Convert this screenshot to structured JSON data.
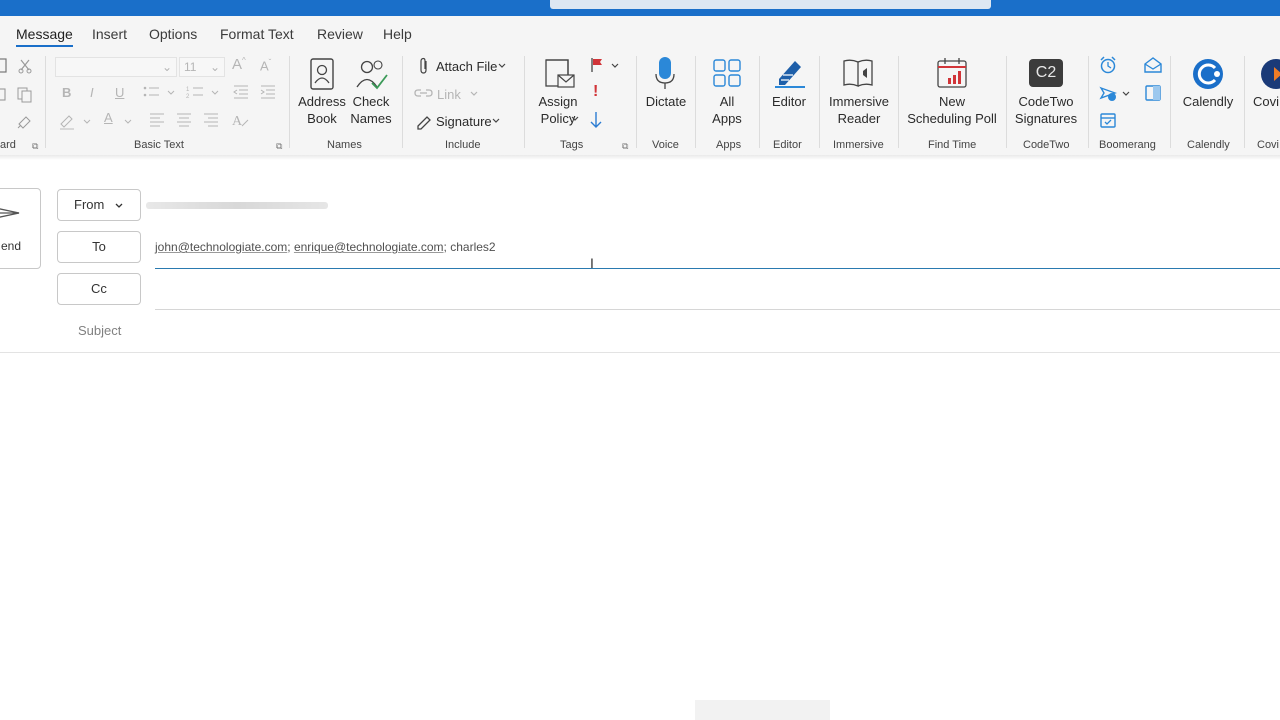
{
  "tabs": [
    "Message",
    "Insert",
    "Options",
    "Format Text",
    "Review",
    "Help"
  ],
  "active_tab": "Message",
  "ribbon": {
    "clipboard_label": "ard",
    "basic_text": {
      "group_label": "Basic Text",
      "font_size": "11",
      "bold": "B",
      "italic": "I",
      "underline": "U"
    },
    "names": {
      "group_label": "Names",
      "address_book": [
        "Address",
        "Book"
      ],
      "check_names": [
        "Check",
        "Names"
      ]
    },
    "include": {
      "group_label": "Include",
      "attach_file": "Attach File",
      "link": "Link",
      "signature": "Signature"
    },
    "tags": {
      "group_label": "Tags",
      "assign_policy": [
        "Assign",
        "Policy"
      ]
    },
    "voice": {
      "group_label": "Voice",
      "dictate": "Dictate"
    },
    "apps": {
      "group_label": "Apps",
      "all_apps": [
        "All",
        "Apps"
      ]
    },
    "editor": {
      "group_label": "Editor",
      "editor": "Editor"
    },
    "immersive": {
      "group_label": "Immersive",
      "reader": [
        "Immersive",
        "Reader"
      ]
    },
    "findtime": {
      "group_label": "Find Time",
      "poll": [
        "New",
        "Scheduling Poll"
      ]
    },
    "codetwo": {
      "group_label": "CodeTwo",
      "signatures": [
        "CodeTwo",
        "Signatures"
      ],
      "logo": "C2"
    },
    "boomerang": {
      "group_label": "Boomerang"
    },
    "calendly": {
      "group_label": "Calendly",
      "label": "Calendly"
    },
    "covi": {
      "group_label": "Covi",
      "label": "Covi"
    }
  },
  "compose": {
    "send_label": "end",
    "from_label": "From",
    "to_label": "To",
    "cc_label": "Cc",
    "subject_placeholder": "Subject",
    "recipients": [
      "john@technologiate.com",
      "enrique@technologiate.com"
    ],
    "typing": "charles2"
  },
  "colors": {
    "accent": "#1a6fc9",
    "flag": "#d13438",
    "codetwo_bg": "#3c3c3c"
  }
}
